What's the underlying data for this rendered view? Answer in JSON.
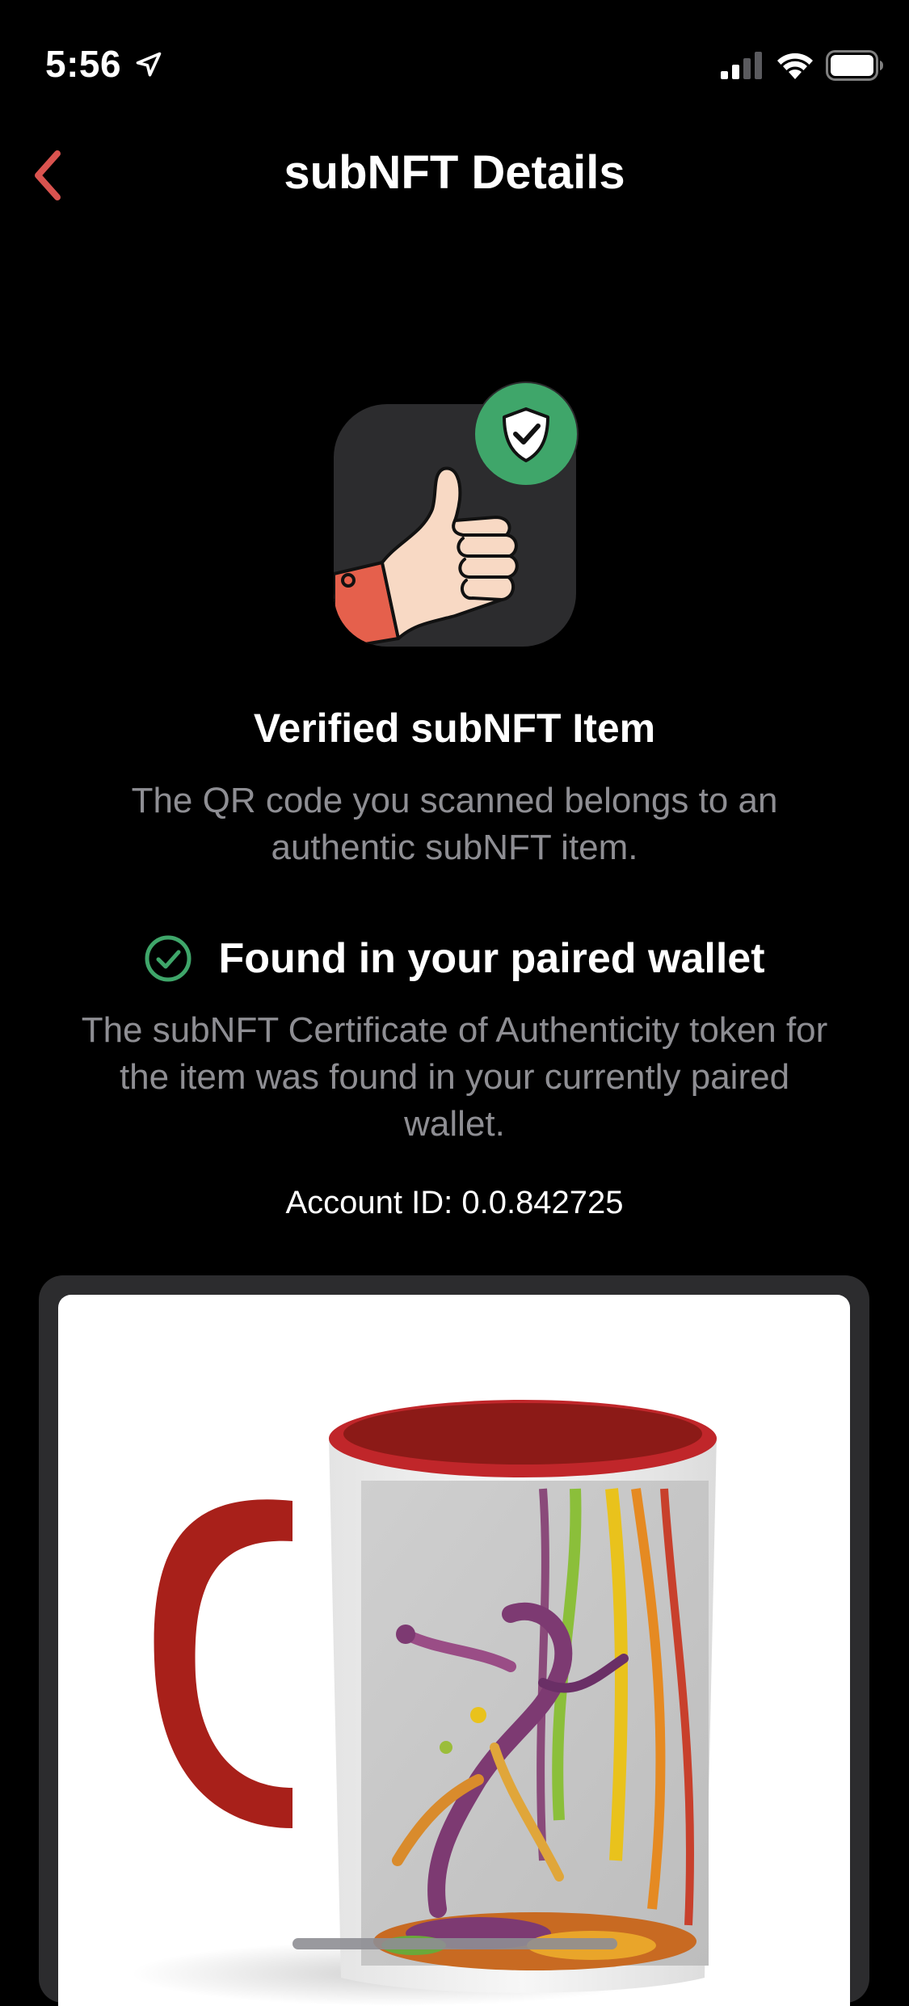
{
  "status_bar": {
    "time": "5:56",
    "location_icon": "location-arrow-icon",
    "signal_icon": "cellular-signal-icon",
    "wifi_icon": "wifi-icon",
    "battery_icon": "battery-icon"
  },
  "nav": {
    "back_icon": "chevron-left-icon",
    "title": "subNFT Details",
    "accent_color": "#d9534f"
  },
  "verification": {
    "illustration": "thumbs-up-icon",
    "badge_icon": "shield-check-icon",
    "title": "Verified subNFT Item",
    "description": "The QR code you scanned belongs to an authentic subNFT item."
  },
  "wallet": {
    "status_icon": "check-circle-icon",
    "status_color": "#3fa66a",
    "title": "Found in your paired wallet",
    "description": "The subNFT Certificate of Authenticity token for the item was found in your currently paired wallet.",
    "account_label": "Account ID:",
    "account_id": "0.0.842725"
  },
  "item": {
    "image": "red-accent-coffee-mug-with-paint-splash-art"
  }
}
